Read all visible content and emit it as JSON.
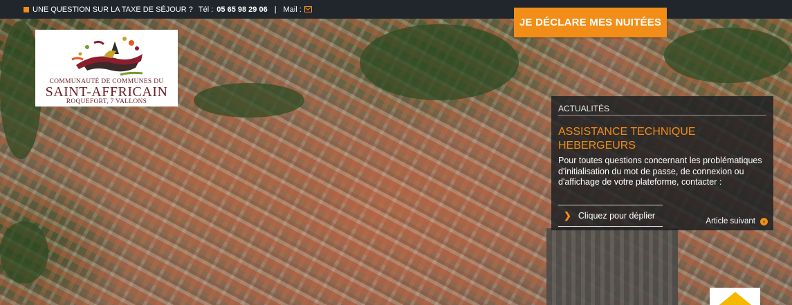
{
  "topbar": {
    "question": "UNE QUESTION SUR LA TAXE DE SÉJOUR ?",
    "phone_label": "Tél :",
    "phone": "05 65 98 29 06",
    "separator": "|",
    "mail_label": "Mail :",
    "mail_icon": "envelope-icon"
  },
  "cta": {
    "declare_label": "JE DÉCLARE MES NUITÉES"
  },
  "logo": {
    "line1": "COMMUNAUTÉ DE COMMUNES DU",
    "line2": "SAINT-AFFRICAIN",
    "line3": "ROQUEFORT, 7 VALLONS"
  },
  "news": {
    "kicker": "ACTUALITÉS",
    "headline": "ASSISTANCE TECHNIQUE HEBERGEURS",
    "body": "Pour toutes questions concernant les problématiques d'initialisation du mot de passe, de connexion ou d'affichage de votre plateforme, contacter :",
    "expand_label": "Cliquez pour déplier",
    "next_label": "Article suivant"
  },
  "colors": {
    "accent": "#f28e17",
    "topbar_bg": "#20262c",
    "logo_text": "#6b1f26",
    "badge_yellow": "#f5b800"
  }
}
